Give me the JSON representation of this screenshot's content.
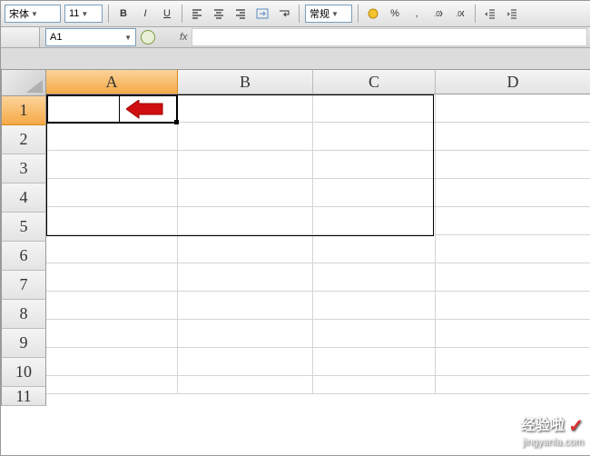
{
  "toolbar": {
    "font_name": "宋体",
    "font_size": "11",
    "number_format": "常规",
    "currency_symbol": "%"
  },
  "namebox": {
    "cell_ref": "A1",
    "fx_label": "fx"
  },
  "columns": [
    "A",
    "B",
    "C",
    "D"
  ],
  "rows": [
    "1",
    "2",
    "3",
    "4",
    "5",
    "6",
    "7",
    "8",
    "9",
    "10",
    "11"
  ],
  "selected_cell": "A1",
  "bordered_range": "A1:C5",
  "watermark": {
    "title": "经验啦",
    "url": "jingyanla.com"
  },
  "icons": {
    "bold": "B",
    "italic": "I",
    "underline": "U",
    "fx": "fx"
  }
}
